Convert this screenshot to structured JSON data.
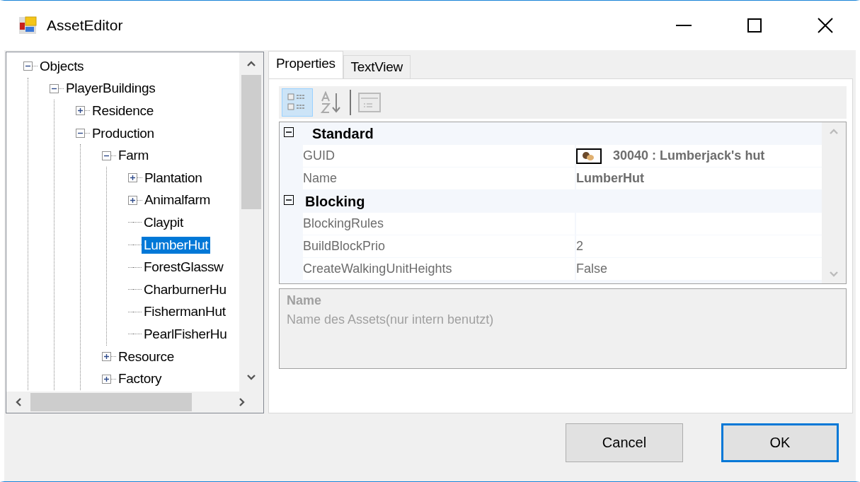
{
  "window": {
    "title": "AssetEditor"
  },
  "tree": [
    {
      "label": "Objects",
      "expanded": true,
      "selected": false,
      "children": [
        {
          "label": "PlayerBuildings",
          "expanded": true,
          "selected": false,
          "children": [
            {
              "label": "Residence",
              "expanded": false,
              "selected": false
            },
            {
              "label": "Production",
              "expanded": true,
              "selected": false,
              "children": [
                {
                  "label": "Farm",
                  "expanded": true,
                  "selected": false,
                  "children": [
                    {
                      "label": "Plantation",
                      "expanded": false,
                      "selected": false
                    },
                    {
                      "label": "Animalfarm",
                      "expanded": false,
                      "selected": false
                    },
                    {
                      "label": "Claypit",
                      "selected": false
                    },
                    {
                      "label": "LumberHut",
                      "selected": true
                    },
                    {
                      "label": "ForestGlassw",
                      "selected": false
                    },
                    {
                      "label": "CharburnerHu",
                      "selected": false
                    },
                    {
                      "label": "FishermanHut",
                      "selected": false
                    },
                    {
                      "label": "PearlFisherHu",
                      "selected": false
                    }
                  ]
                },
                {
                  "label": "Resource",
                  "expanded": false,
                  "selected": false
                },
                {
                  "label": "Factory",
                  "expanded": false,
                  "selected": false
                }
              ]
            }
          ]
        }
      ]
    }
  ],
  "tabs": [
    {
      "label": "Properties",
      "selected": true
    },
    {
      "label": "TextView",
      "selected": false
    }
  ],
  "toolbar": [
    {
      "kind": "categorized",
      "selected": true,
      "disabled": false
    },
    {
      "kind": "alphabetical",
      "selected": false,
      "disabled": false
    },
    {
      "kind": "pages",
      "selected": false,
      "disabled": true
    }
  ],
  "categories": [
    {
      "name": "Standard",
      "expanded": true,
      "properties": [
        {
          "name": "GUID",
          "value": "30040 : Lumberjack's hut",
          "kind": "reference",
          "modified": true
        },
        {
          "name": "Name",
          "value": "LumberHut",
          "kind": "text",
          "modified": true
        }
      ]
    },
    {
      "name": "Blocking",
      "expanded": true,
      "properties": [
        {
          "name": "BlockingRules",
          "kind": "text",
          "modified": false
        },
        {
          "name": "BuildBlockPrio",
          "value": "2",
          "kind": "text",
          "modified": false
        },
        {
          "name": "CreateWalkingUnitHeights",
          "value": "False",
          "kind": "text",
          "modified": false
        }
      ]
    }
  ],
  "description": {
    "title": "Name",
    "text": "Name des Assets(nur intern benutzt)"
  },
  "buttons": [
    {
      "label": "Cancel",
      "default": false
    },
    {
      "label": "OK",
      "default": true
    }
  ]
}
